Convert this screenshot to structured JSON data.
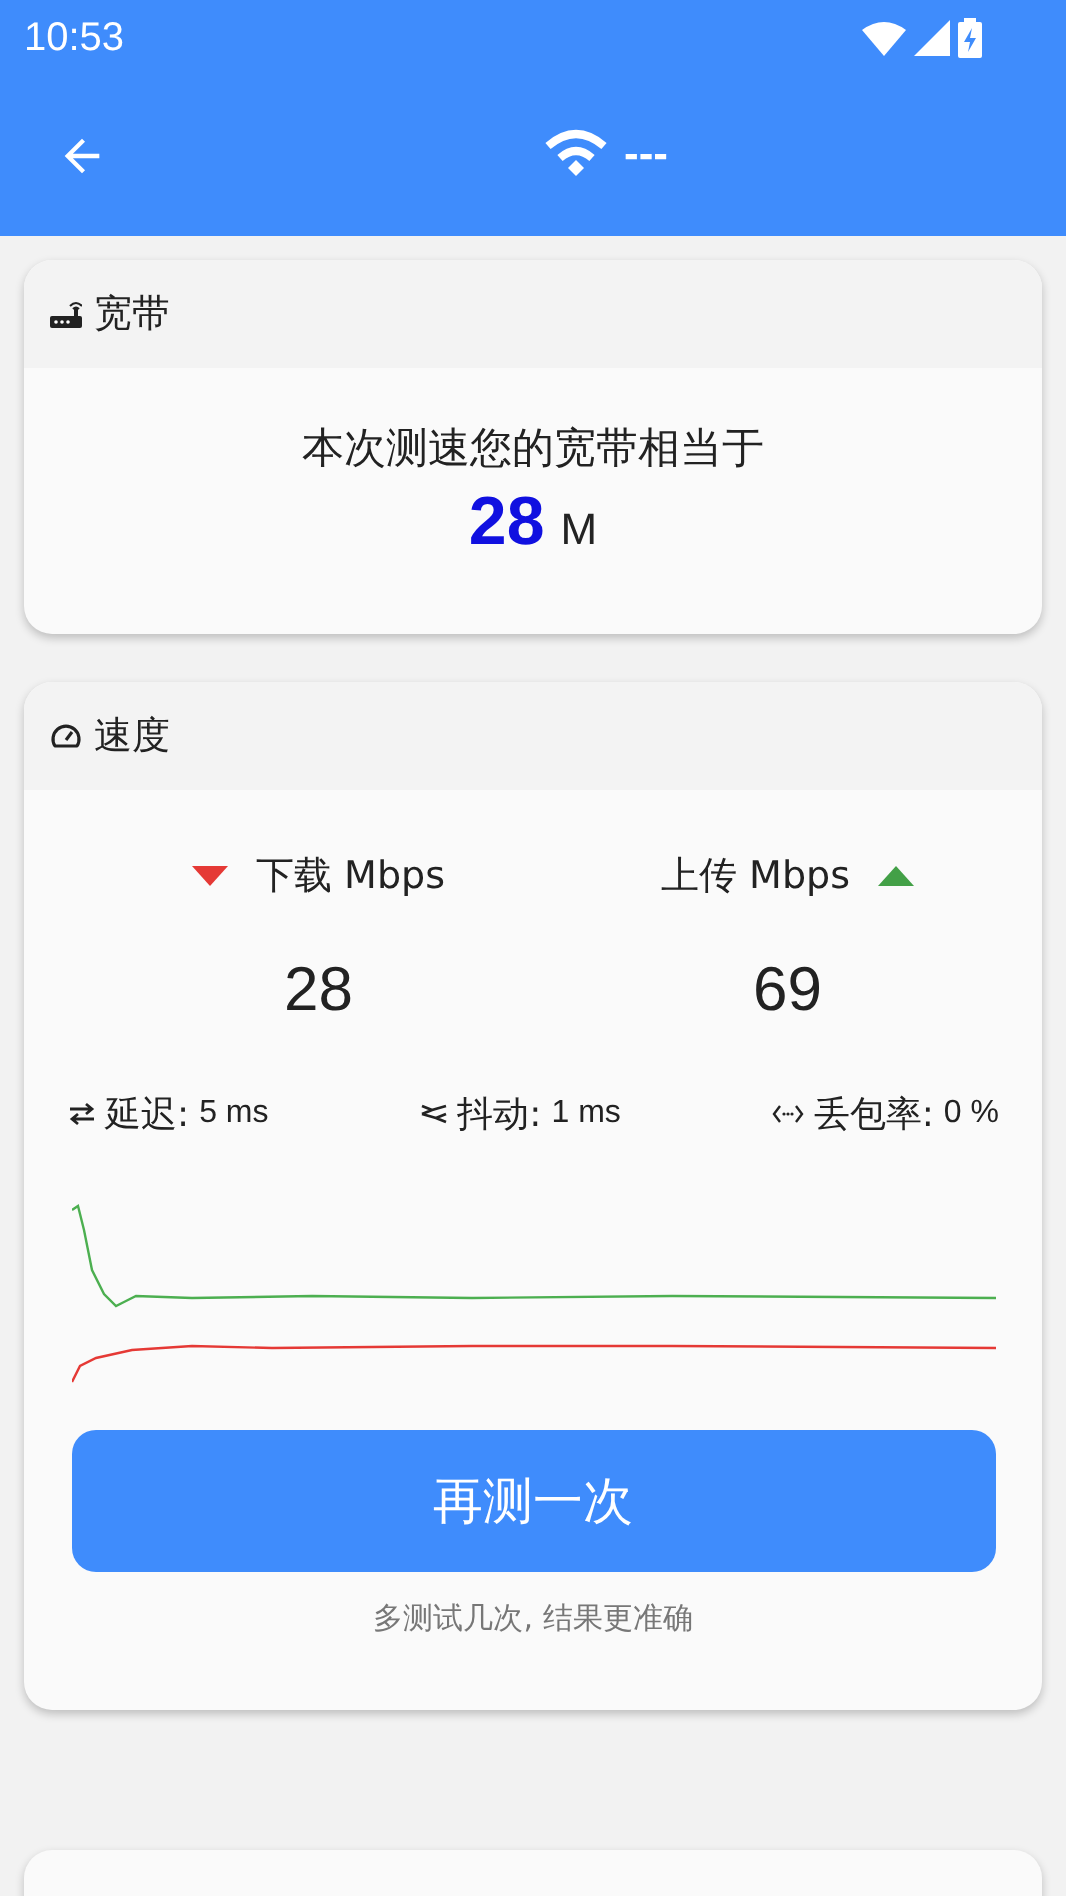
{
  "status_bar": {
    "time": "10:53"
  },
  "app_bar": {
    "title": "---"
  },
  "broadband": {
    "title": "宽带",
    "sentence": "本次测速您的宽带相当于",
    "value": "28",
    "unit": "M"
  },
  "speed": {
    "title": "速度",
    "download": {
      "label": "下载 Mbps",
      "value": "28"
    },
    "upload": {
      "label": "上传 Mbps",
      "value": "69"
    },
    "stats": [
      {
        "kind": "latency",
        "label": "延迟:",
        "value": "5 ms"
      },
      {
        "kind": "jitter",
        "label": "抖动:",
        "value": "1 ms"
      },
      {
        "kind": "loss",
        "label": "丢包率:",
        "value": "0 %"
      }
    ],
    "retest_button": "再测一次",
    "hint": "多测试几次, 结果更准确"
  }
}
